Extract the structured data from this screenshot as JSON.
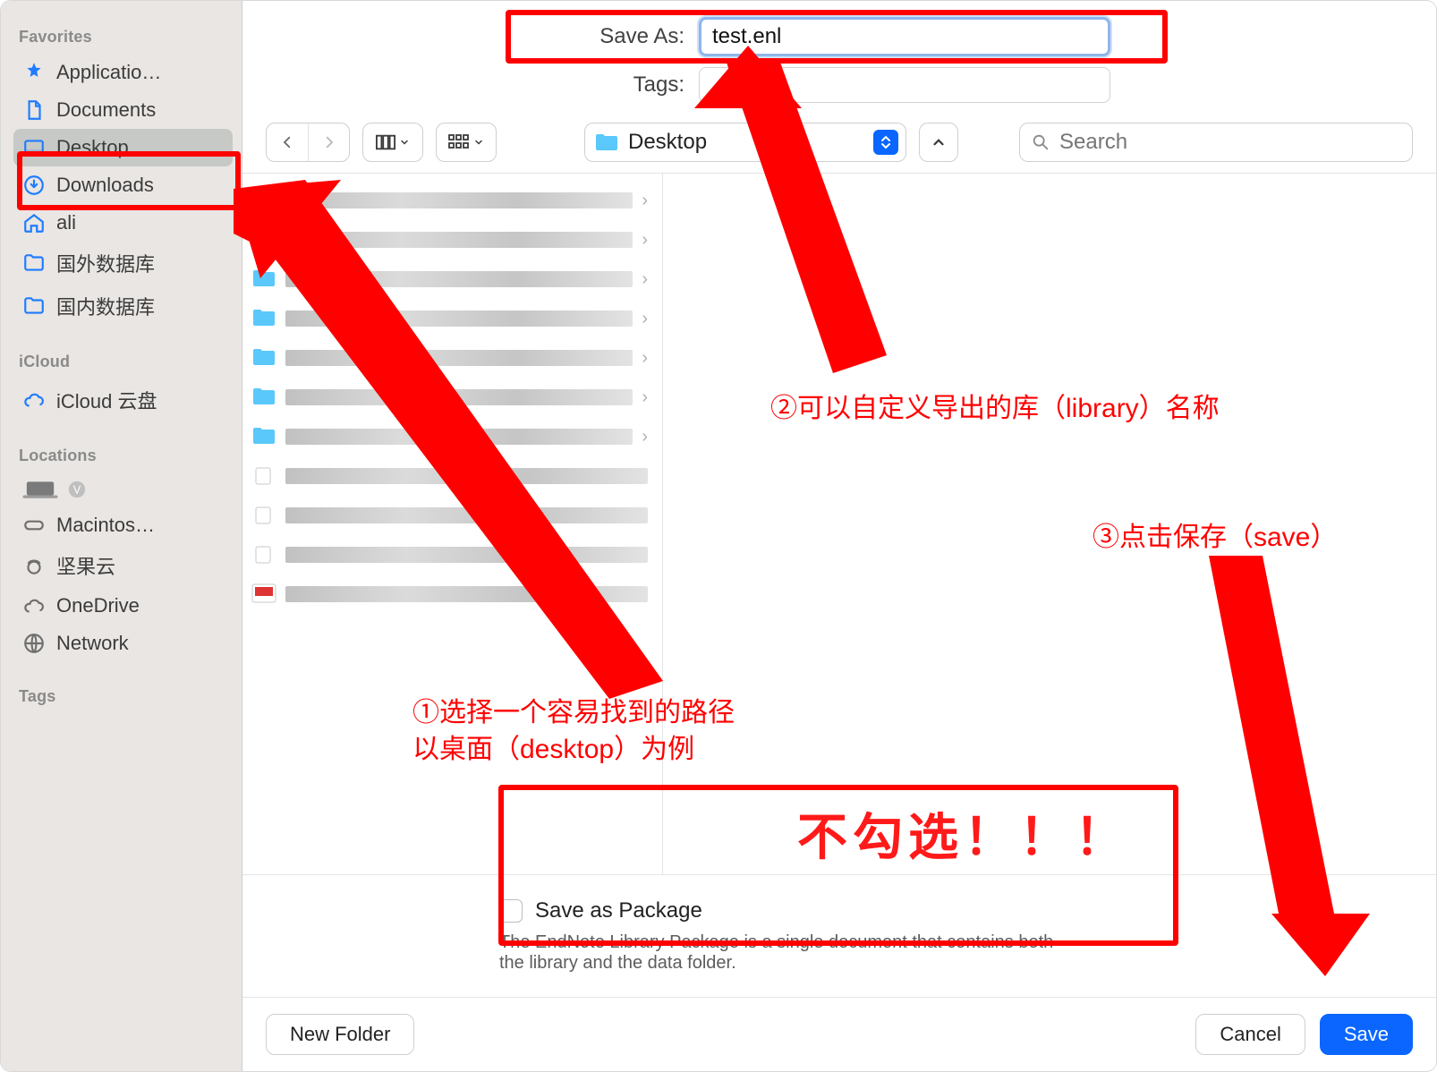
{
  "sidebar": {
    "headings": {
      "favorites": "Favorites",
      "icloud": "iCloud",
      "locations": "Locations",
      "tags": "Tags"
    },
    "favorites": [
      {
        "label": "Applicatio…"
      },
      {
        "label": "Documents"
      },
      {
        "label": "Desktop"
      },
      {
        "label": "Downloads"
      },
      {
        "label": "ali"
      },
      {
        "label": "国外数据库"
      },
      {
        "label": "国内数据库"
      }
    ],
    "icloud": [
      {
        "label": "iCloud 云盘"
      }
    ],
    "locations": [
      {
        "label": "Macintos…"
      },
      {
        "label": "坚果云"
      },
      {
        "label": "OneDrive"
      },
      {
        "label": "Network"
      }
    ]
  },
  "top": {
    "saveas_label": "Save As:",
    "saveas_value": "test.enl",
    "tags_label": "Tags:"
  },
  "toolbar": {
    "location": "Desktop",
    "search_placeholder": "Search"
  },
  "package": {
    "label": "Save as Package",
    "desc": "The EndNote Library Package is a single document that contains both the library and the data folder."
  },
  "footer": {
    "newfolder": "New Folder",
    "cancel": "Cancel",
    "save": "Save"
  },
  "annotations": {
    "a1_line1": "①选择一个容易找到的路径",
    "a1_line2": "以桌面（desktop）为例",
    "a2": "②可以自定义导出的库（library）名称",
    "a3": "③点击保存（save）",
    "nocheck": "不勾选！！！"
  },
  "browser": {
    "rows": [
      {
        "kind": "folder-yellow"
      },
      {
        "kind": "folder-yellow"
      },
      {
        "kind": "folder-blue"
      },
      {
        "kind": "folder-blue"
      },
      {
        "kind": "folder-blue"
      },
      {
        "kind": "folder-blue"
      },
      {
        "kind": "folder-blue"
      },
      {
        "kind": "file"
      },
      {
        "kind": "file"
      },
      {
        "kind": "file"
      },
      {
        "kind": "image"
      }
    ]
  }
}
